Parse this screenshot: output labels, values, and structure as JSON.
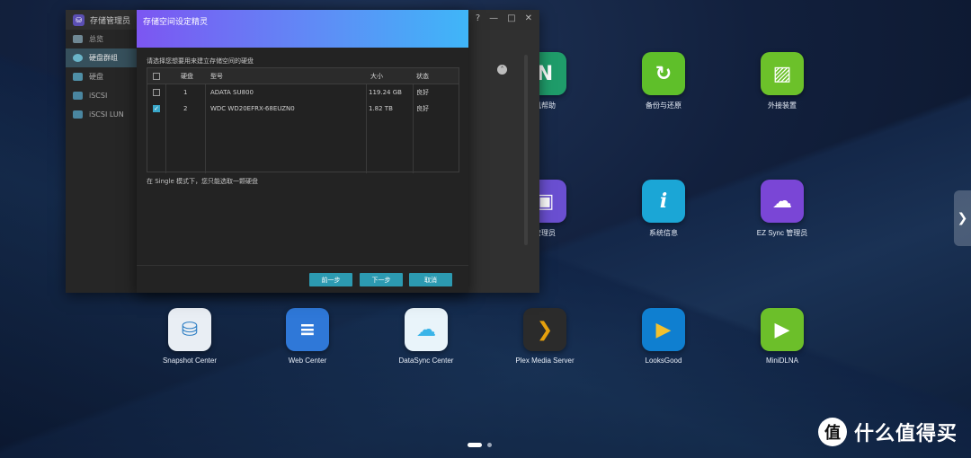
{
  "desktop": {
    "apps": [
      {
        "label": "机帮助",
        "color": "#1f9c6a",
        "glyph": "N",
        "icon": "compass-map-icon"
      },
      {
        "label": "备份与还原",
        "color": "#5fbf2a",
        "glyph": "↻",
        "icon": "backup-restore-icon"
      },
      {
        "label": "外接装置",
        "color": "#6cc12a",
        "glyph": "▨",
        "icon": "external-device-icon"
      },
      {
        "label": "管理员",
        "color": "#6a4fd1",
        "glyph": "▣",
        "icon": "manager-icon"
      },
      {
        "label": "系统信息",
        "color": "#1ba6d6",
        "glyph": "i",
        "icon": "info-icon"
      },
      {
        "label": "EZ Sync 管理员",
        "color": "#7a46d6",
        "glyph": "☁",
        "icon": "ezsync-cloud-icon"
      },
      {
        "label": "Snapshot Center",
        "color": "#2f7fc4",
        "glyph": "⛁",
        "icon": "snapshot-database-icon"
      },
      {
        "label": "Web Center",
        "color": "#2f78d8",
        "glyph": "≡",
        "icon": "web-server-icon"
      },
      {
        "label": "DataSync Center",
        "color": "#3ab4e8",
        "glyph": "☁",
        "icon": "datasync-cloud-icon"
      },
      {
        "label": "Plex Media Server",
        "color": "#2b2b2b",
        "glyph": "❯",
        "icon": "plex-icon"
      },
      {
        "label": "LooksGood",
        "color": "#0f7fd0",
        "glyph": "▶",
        "icon": "looksgood-play-icon"
      },
      {
        "label": "MiniDLNA",
        "color": "#6cbf2a",
        "glyph": "▶",
        "icon": "minidlna-play-icon"
      }
    ]
  },
  "storage_window": {
    "title": "存储管理员",
    "controls": [
      "?",
      "—",
      "□",
      "✕"
    ],
    "sidebar": [
      {
        "label": "总览",
        "active": false
      },
      {
        "label": "硬盘群组",
        "active": true
      },
      {
        "label": "硬盘",
        "active": false
      },
      {
        "label": "iSCSI",
        "active": false
      },
      {
        "label": "iSCSI LUN",
        "active": false
      }
    ]
  },
  "wizard": {
    "title": "存储空间设定精灵",
    "prompt": "请选择您想要用来建立存储空间的硬盘",
    "table": {
      "headers": [
        "硬盘",
        "型号",
        "大小",
        "状态"
      ],
      "rows": [
        {
          "checked": false,
          "disk": "1",
          "model": "ADATA SU800",
          "size": "119.24 GB",
          "status": "良好"
        },
        {
          "checked": true,
          "disk": "2",
          "model": "WDC WD20EFRX-68EUZN0",
          "size": "1.82 TB",
          "status": "良好"
        }
      ]
    },
    "note": "在 Single 模式下，您只能选取一颗硬盘",
    "buttons": {
      "prev": "前一步",
      "next": "下一步",
      "cancel": "取消"
    },
    "accent_color": "#2c9ab1"
  },
  "watermark": {
    "text": "什么值得买",
    "glyph": "值"
  }
}
